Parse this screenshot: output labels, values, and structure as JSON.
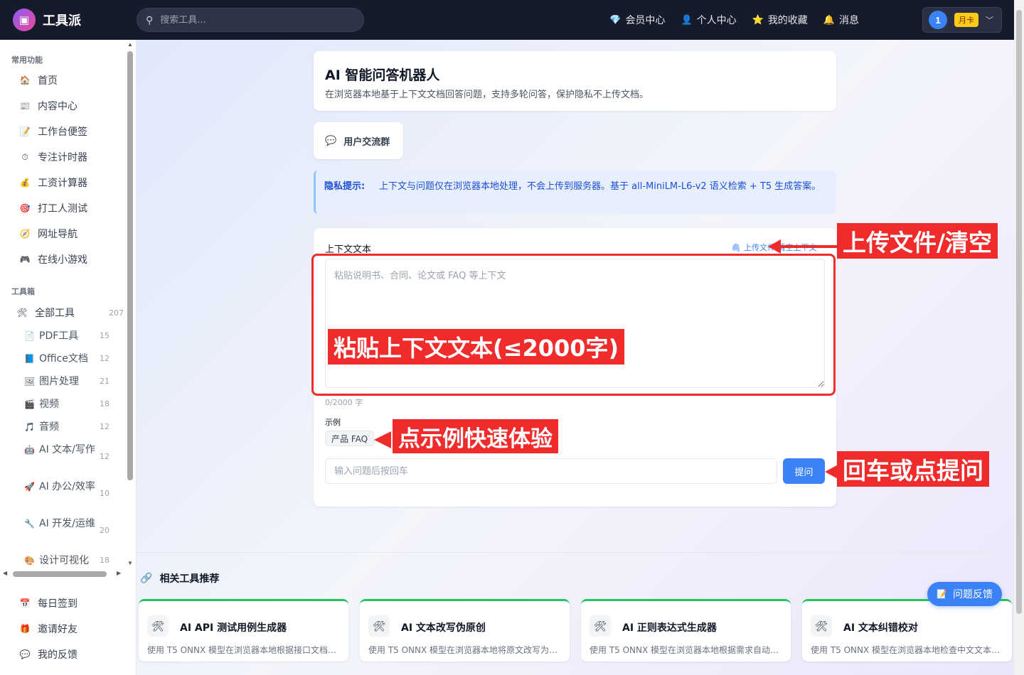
{
  "app": {
    "logo_icon": "briefcase-icon",
    "name": "工具派"
  },
  "search": {
    "placeholder": "搜索工具..."
  },
  "topnav": {
    "items": [
      {
        "icon": "diamond-icon",
        "glyph": "💎",
        "label": "会员中心"
      },
      {
        "icon": "person-icon",
        "glyph": "👤",
        "label": "个人中心"
      },
      {
        "icon": "star-icon",
        "glyph": "⭐",
        "label": "我的收藏"
      },
      {
        "icon": "bell-icon",
        "glyph": "🔔",
        "label": "消息"
      }
    ],
    "user": {
      "avatar": "1",
      "badge": "月卡"
    }
  },
  "sidebar": {
    "common_title": "常用功能",
    "common": [
      {
        "glyph": "🏠",
        "label": "首页"
      },
      {
        "glyph": "📰",
        "label": "内容中心"
      },
      {
        "glyph": "📝",
        "label": "工作台便签"
      },
      {
        "glyph": "⏱",
        "label": "专注计时器"
      },
      {
        "glyph": "💰",
        "label": "工资计算器"
      },
      {
        "glyph": "🎯",
        "label": "打工人测试"
      },
      {
        "glyph": "🧭",
        "label": "网址导航"
      },
      {
        "glyph": "🎮",
        "label": "在线小游戏"
      }
    ],
    "toolbox_title": "工具箱",
    "all_tools": {
      "glyph": "🛠",
      "label": "全部工具",
      "count": "207"
    },
    "tools": [
      {
        "glyph": "📄",
        "label": "PDF工具",
        "count": "15"
      },
      {
        "glyph": "📘",
        "label": "Office文档",
        "count": "12"
      },
      {
        "glyph": "🖼",
        "label": "图片处理",
        "count": "21"
      },
      {
        "glyph": "🎬",
        "label": "视频",
        "count": "18"
      },
      {
        "glyph": "🎵",
        "label": "音频",
        "count": "12"
      },
      {
        "glyph": "🤖",
        "label": "AI 文本/写作",
        "count": "12"
      },
      {
        "glyph": "🚀",
        "label": "AI 办公/效率",
        "count": "10"
      },
      {
        "glyph": "🔧",
        "label": "AI 开发/运维",
        "count": "20"
      },
      {
        "glyph": "🎨",
        "label": "设计可视化",
        "count": "18"
      }
    ],
    "bottom": [
      {
        "glyph": "📅",
        "label": "每日签到"
      },
      {
        "glyph": "🎁",
        "label": "邀请好友"
      },
      {
        "glyph": "💬",
        "label": "我的反馈"
      }
    ]
  },
  "header": {
    "title": "AI 智能问答机器人",
    "description": "在浏览器本地基于上下文文档回答问题，支持多轮问答，保护隐私不上传文档。"
  },
  "community": {
    "glyph": "💬",
    "label": "用户交流群"
  },
  "privacy": {
    "label": "隐私提示:",
    "text": "上下文与问题仅在浏览器本地处理，不会上传到服务器。基于 all-MiniLM-L6-v2 语义检索 + T5 生成答案。"
  },
  "form": {
    "context_label": "上下文文本",
    "upload_link": "上传文件 清空上下文",
    "context_placeholder": "粘贴说明书、合同、论文或 FAQ 等上下文",
    "char_count": "0/2000 字",
    "examples_label": "示例",
    "example_chip": "产品 FAQ",
    "question_placeholder": "输入问题后按回车",
    "ask_button": "提问"
  },
  "annotations": {
    "upload": "上传文件/清空",
    "paste": "粘贴上下文文本(≤2000字)",
    "example": "点示例快速体验",
    "ask": "回车或点提问",
    "color": "#ef2b2b"
  },
  "related": {
    "title": "相关工具推荐",
    "cards": [
      {
        "title": "AI API 测试用例生成器",
        "desc": "使用 T5 ONNX 模型在浏览器本地根据接口文档生..."
      },
      {
        "title": "AI 文本改写伪原创",
        "desc": "使用 T5 ONNX 模型在浏览器本地将原文改写为学..."
      },
      {
        "title": "AI 正则表达式生成器",
        "desc": "使用 T5 ONNX 模型在浏览器本地根据需求自动生..."
      },
      {
        "title": "AI 文本纠错校对",
        "desc": "使用 T5 ONNX 模型在浏览器本地检查中文文本的..."
      }
    ]
  },
  "feedback": {
    "label": "问题反馈"
  }
}
